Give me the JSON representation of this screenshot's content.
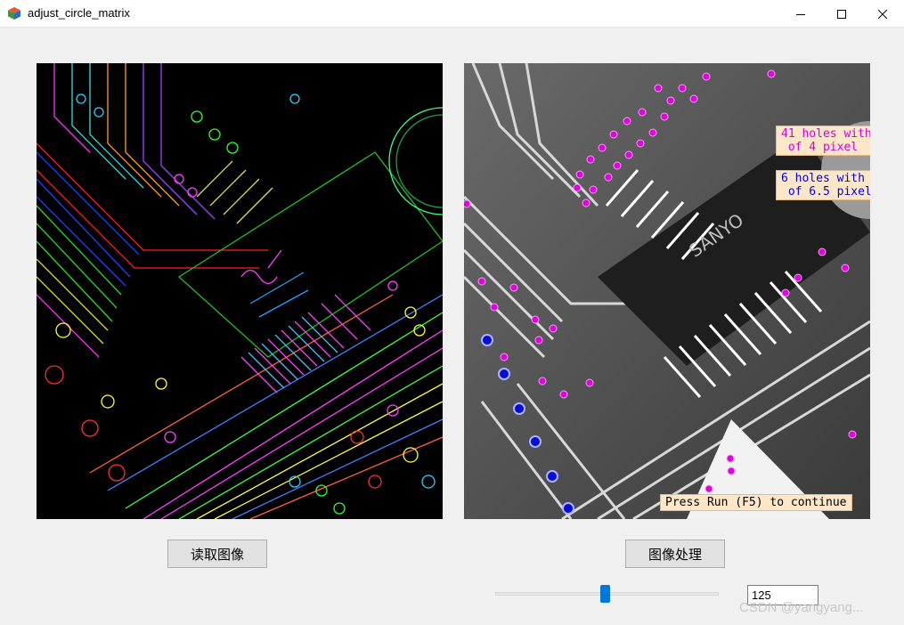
{
  "window": {
    "title": "adjust_circle_matrix",
    "app_icon": "app-cube-icon",
    "controls": [
      "minimize-icon",
      "maximize-icon",
      "close-icon"
    ]
  },
  "left_panel": {
    "description_icon": "edge-detection-image"
  },
  "right_panel": {
    "overlay_magenta": "41 holes with\n of 4 pixel ",
    "overlay_blue": "6 holes with\n of 6.5 pixel",
    "overlay_continue": "Press Run (F5) to continue",
    "colors": {
      "magenta": "#e000e0",
      "blue": "#0010d0"
    }
  },
  "buttons": {
    "read_image": "读取图像",
    "process_image": "图像处理"
  },
  "slider": {
    "value": "125",
    "fraction": 0.49
  },
  "watermark": "CSDN @yangyang..."
}
